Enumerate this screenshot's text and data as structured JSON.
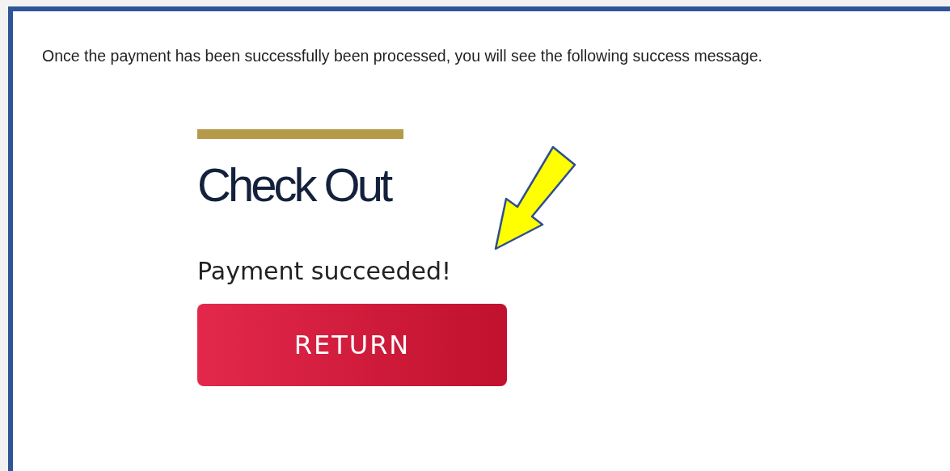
{
  "intro": "Once the payment has been successfully been processed, you will see the following success message.",
  "checkout": {
    "title": "Check Out",
    "message": "Payment succeeded!",
    "button": "RETURN"
  }
}
